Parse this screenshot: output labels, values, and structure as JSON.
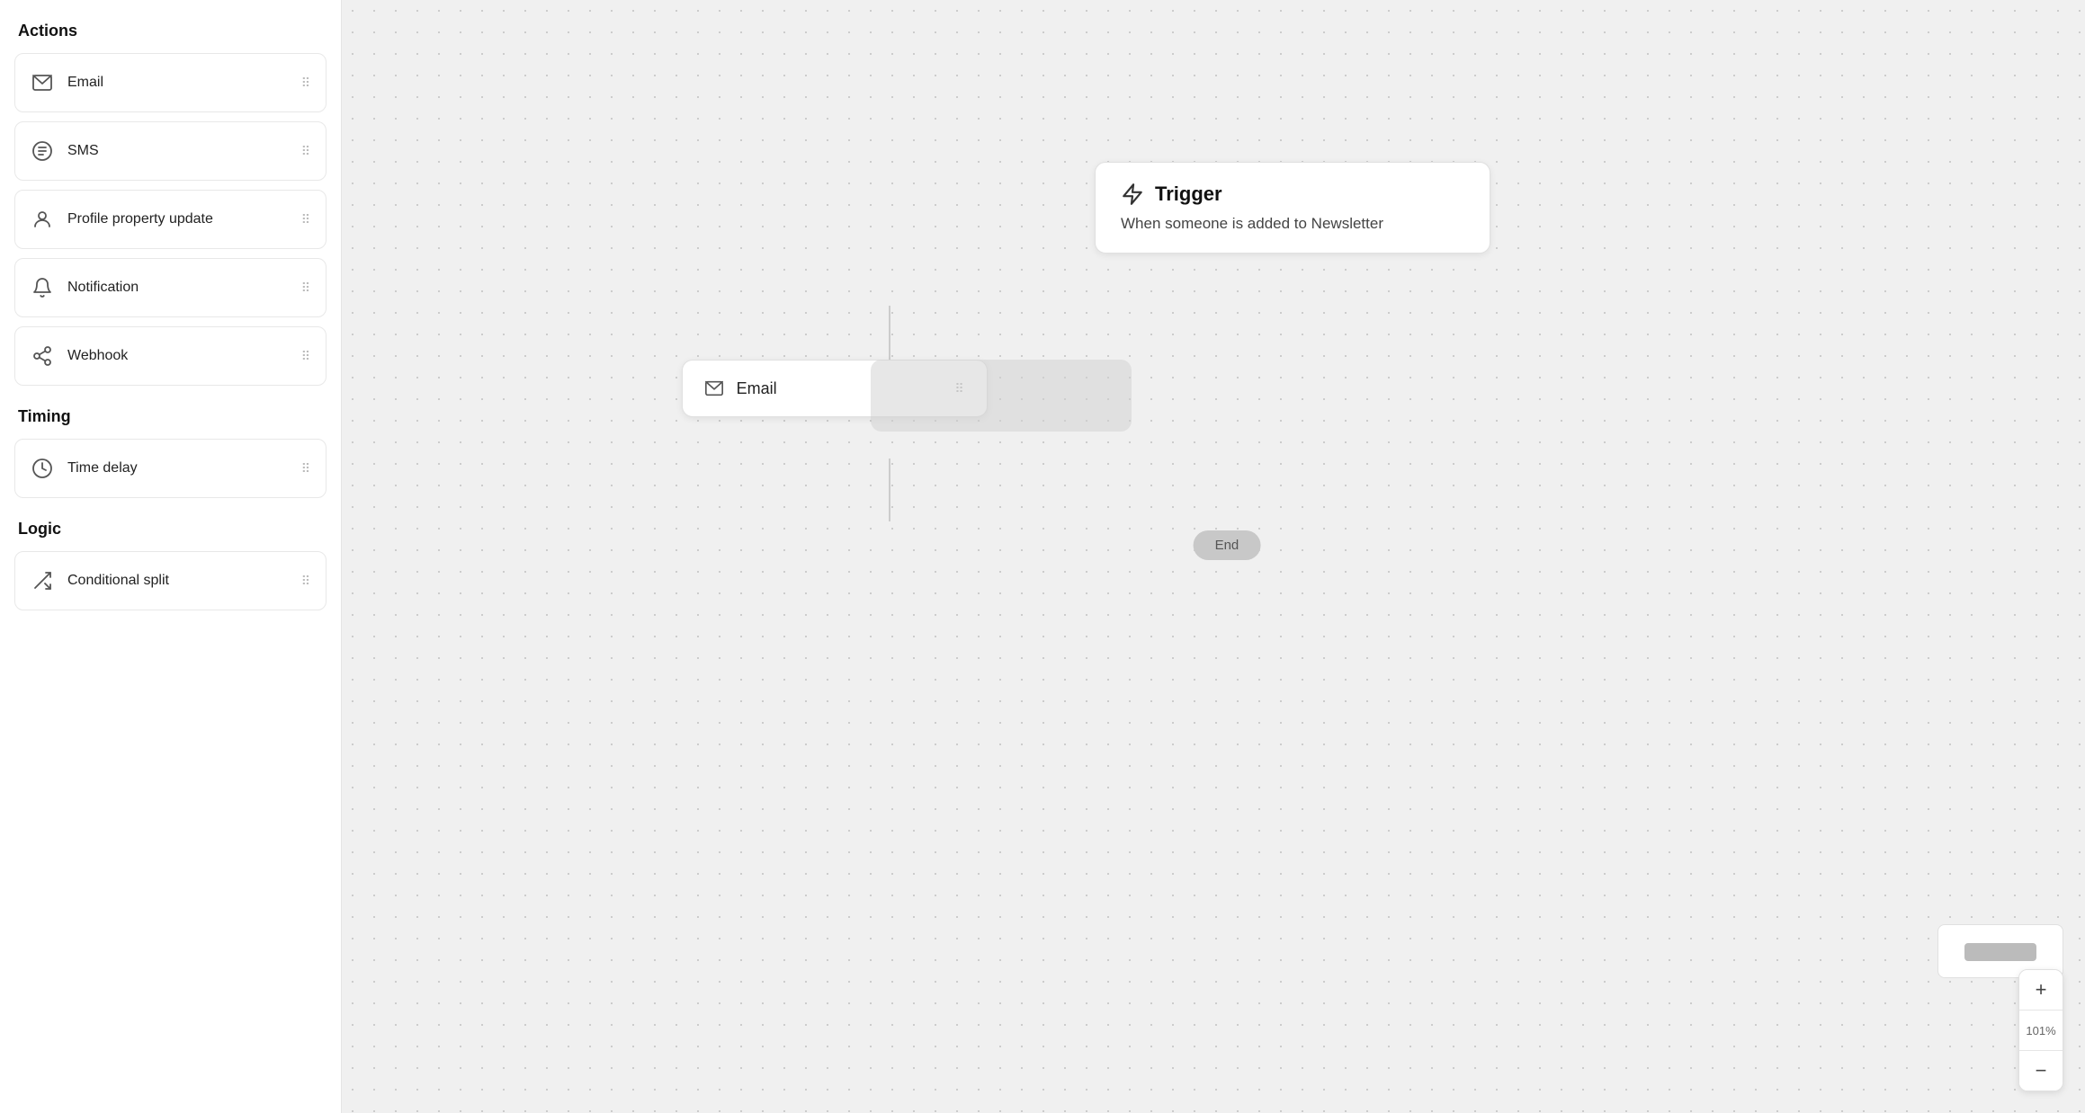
{
  "sidebar": {
    "sections": [
      {
        "title": "Actions",
        "items": [
          {
            "id": "email",
            "label": "Email",
            "icon": "mail"
          },
          {
            "id": "sms",
            "label": "SMS",
            "icon": "sms"
          },
          {
            "id": "profile-property-update",
            "label": "Profile property update",
            "icon": "person"
          },
          {
            "id": "notification",
            "label": "Notification",
            "icon": "bell"
          },
          {
            "id": "webhook",
            "label": "Webhook",
            "icon": "webhook"
          }
        ]
      },
      {
        "title": "Timing",
        "items": [
          {
            "id": "time-delay",
            "label": "Time delay",
            "icon": "clock"
          }
        ]
      },
      {
        "title": "Logic",
        "items": [
          {
            "id": "conditional-split",
            "label": "Conditional split",
            "icon": "split"
          }
        ]
      }
    ]
  },
  "canvas": {
    "trigger": {
      "title": "Trigger",
      "subtitle": "When someone is added to Newsletter"
    },
    "email_node": {
      "label": "Email"
    },
    "end_badge": "End"
  },
  "zoom": {
    "level": "101%",
    "plus_label": "+",
    "minus_label": "−"
  }
}
